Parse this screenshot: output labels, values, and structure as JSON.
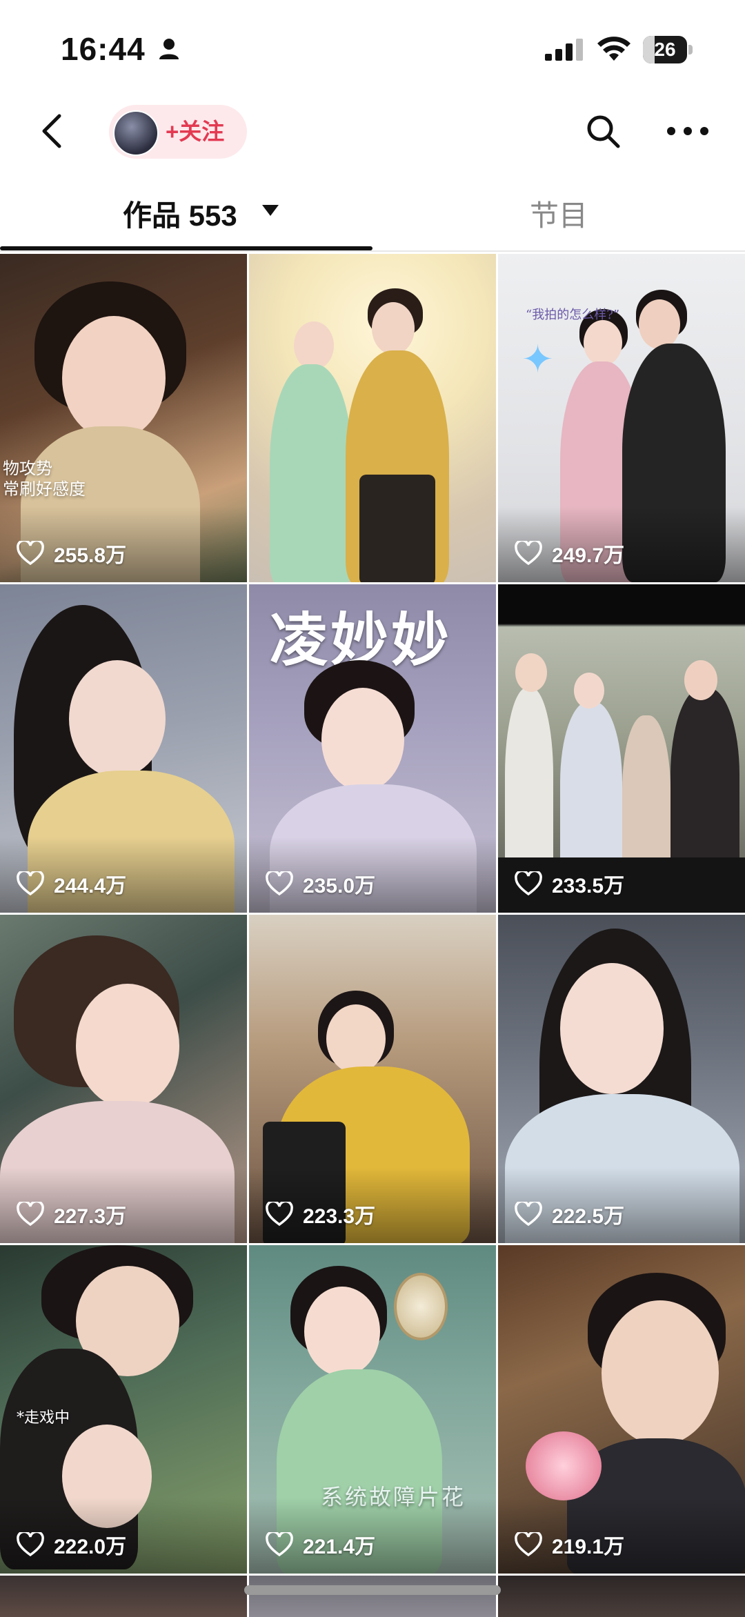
{
  "status_bar": {
    "time": "16:44",
    "battery": "26",
    "battery_level": 0.26,
    "icons": [
      "person-icon",
      "signal-icon",
      "wifi-icon",
      "battery-icon"
    ]
  },
  "header": {
    "follow_label": "+关注",
    "icons": [
      "back-arrow-icon",
      "search-icon",
      "more-dots-icon"
    ]
  },
  "tabs": {
    "works_label": "作品 553",
    "shows_label": "节目"
  },
  "videos": [
    {
      "likes": "255.8万",
      "caption": "物攻势\n常刷好感度"
    },
    {
      "likes": "",
      "caption": ""
    },
    {
      "likes": "249.7万",
      "caption": "“我拍的怎么样?”"
    },
    {
      "likes": "244.4万",
      "caption": ""
    },
    {
      "likes": "235.0万",
      "caption": "凌妙妙"
    },
    {
      "likes": "233.5万",
      "caption": ""
    },
    {
      "likes": "227.3万",
      "caption": ""
    },
    {
      "likes": "223.3万",
      "caption": ""
    },
    {
      "likes": "222.5万",
      "caption": ""
    },
    {
      "likes": "222.0万",
      "caption": "*走戏中"
    },
    {
      "likes": "221.4万",
      "caption": "系统故障片花"
    },
    {
      "likes": "219.1万",
      "caption": ""
    }
  ],
  "colors": {
    "follow_accent": "#e33a52",
    "follow_bg": "#fde9ec",
    "inactive_tab": "#888888"
  }
}
